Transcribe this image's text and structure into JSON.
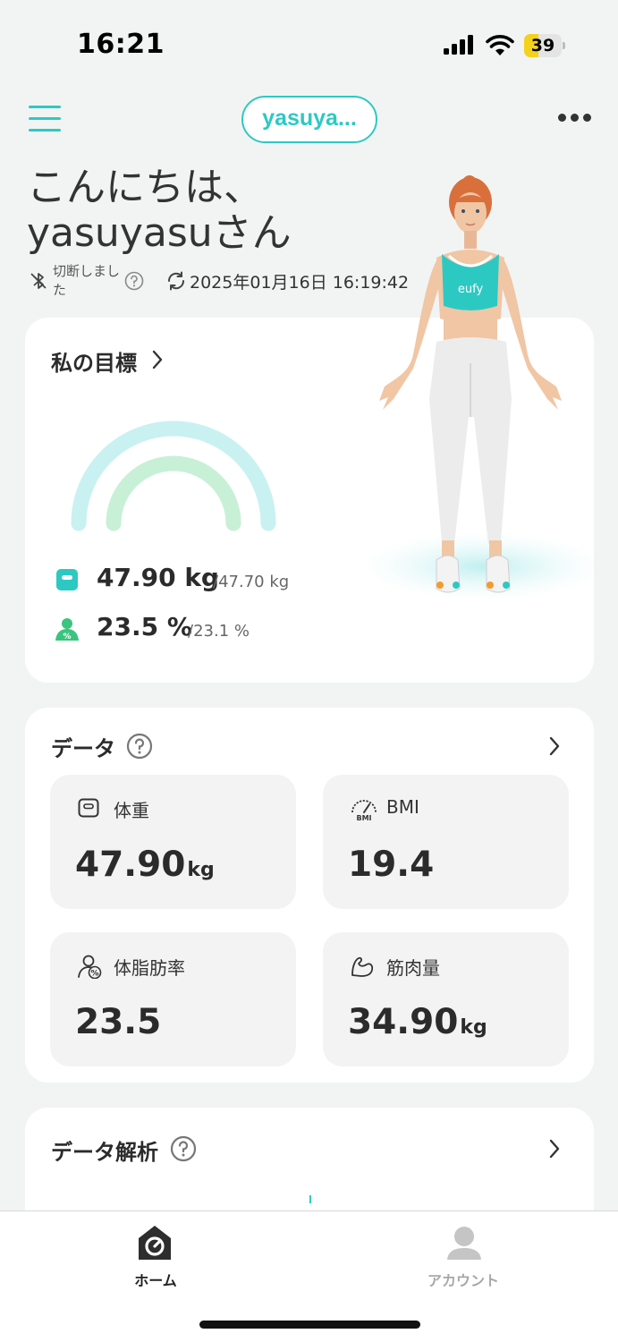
{
  "status_bar": {
    "time": "16:21",
    "battery_level": "39",
    "battery_fraction": 0.39
  },
  "header": {
    "username": "yasuya..."
  },
  "greeting": {
    "line1": "こんにちは、",
    "line2": "yasuyasuさん"
  },
  "connection": {
    "status": "切断しました",
    "sync_time": "2025年01月16日 16:19:42"
  },
  "goal": {
    "title": "私の目標",
    "weight_value": "47.90 kg",
    "weight_target": "/47.70 kg",
    "bodyfat_value": "23.5 %",
    "bodyfat_target": "/23.1 %",
    "avatar_logo": "eufy"
  },
  "data": {
    "title": "データ",
    "tiles": [
      {
        "label": "体重",
        "value": "47.90",
        "unit": "kg",
        "icon": "scale-icon"
      },
      {
        "label": "BMI",
        "value": "19.4",
        "unit": "",
        "icon": "bmi-gauge-icon",
        "icon_text": "BMI"
      },
      {
        "label": "体脂肪率",
        "value": "23.5",
        "unit": "",
        "icon": "body-fat-icon"
      },
      {
        "label": "筋肉量",
        "value": "34.90",
        "unit": "kg",
        "icon": "muscle-icon"
      }
    ]
  },
  "analysis": {
    "title": "データ解析"
  },
  "nav": {
    "home": "ホーム",
    "account": "アカウント"
  },
  "colors": {
    "accent": "#2cc9c3",
    "gauge_outer": "#c9f1f1",
    "gauge_inner": "#c8f0d6",
    "bodyfat_green": "#3ac47d",
    "battery_yellow": "#f4d21c"
  }
}
